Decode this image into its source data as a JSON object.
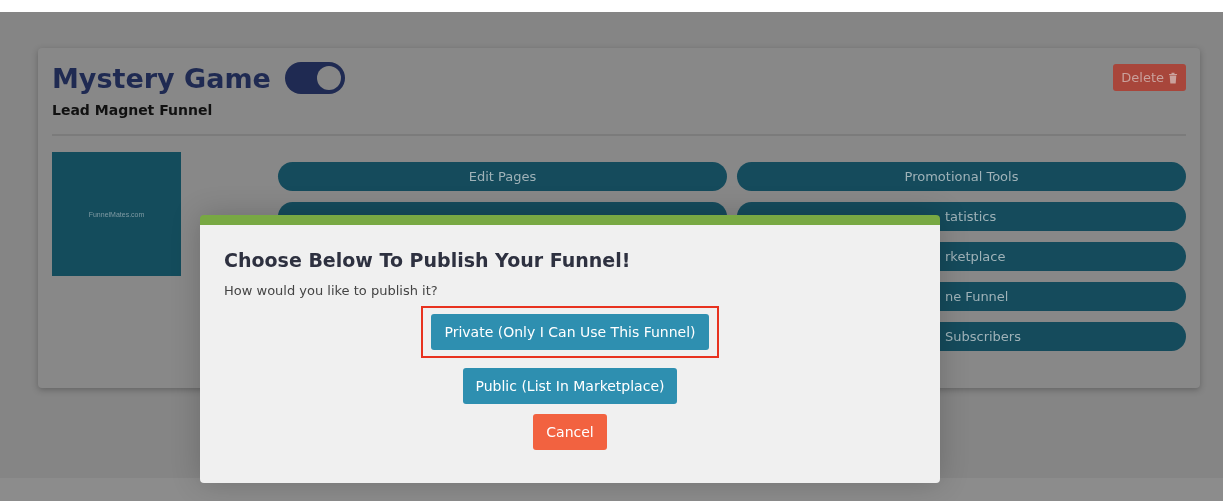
{
  "funnel": {
    "title": "Mystery Game",
    "enabled": true,
    "subtitle": "Lead Magnet Funnel",
    "delete_label": "Delete",
    "thumbnail_text": "FunnelMates.com"
  },
  "left_actions": [
    {
      "label": "Edit Pages"
    }
  ],
  "right_actions": [
    {
      "label": "Promotional Tools",
      "kind": "full"
    },
    {
      "label": "tatistics",
      "kind": "cut"
    },
    {
      "label": "rketplace",
      "kind": "cut"
    },
    {
      "label": "ne Funnel",
      "kind": "cut"
    },
    {
      "label": "Subscribers",
      "kind": "cut"
    }
  ],
  "dialog": {
    "title": "Choose Below To Publish Your Funnel!",
    "prompt": "How would you like to publish it?",
    "options": [
      {
        "label": "Private (Only I Can Use This Funnel)",
        "kind": "primary",
        "highlighted": true
      },
      {
        "label": "Public (List In Marketplace)",
        "kind": "primary",
        "highlighted": false
      },
      {
        "label": "Cancel",
        "kind": "cancel",
        "highlighted": false
      }
    ]
  }
}
